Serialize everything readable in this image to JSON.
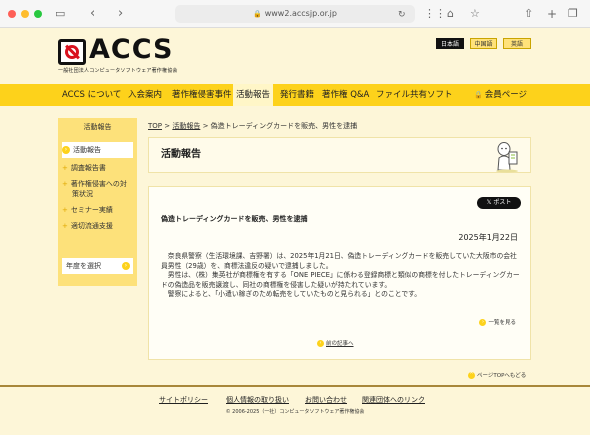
{
  "browser": {
    "url": "www2.accsjp.or.jp"
  },
  "header": {
    "logo": "ACCS",
    "logo_sub": "一般社団法人コンピュータソフトウェア著作権協会",
    "langs": [
      "日本語",
      "中国語",
      "英語"
    ]
  },
  "nav": {
    "items": [
      "ACCS について",
      "入会案内",
      "著作権侵害事件",
      "活動報告",
      "発行書籍",
      "著作権 Q&A",
      "ファイル共有ソフト"
    ],
    "member": "会員ページ"
  },
  "sidebar": {
    "title": "活動報告",
    "items": [
      "活動報告",
      "調査報告書",
      "著作権侵害への対策状況",
      "セミナー実績",
      "適切流通支援"
    ],
    "year_select": "年度を選択"
  },
  "breadcrumb": {
    "top": "TOP",
    "report": "活動報告",
    "current": "偽造トレーディングカードを販売、男性を逮捕"
  },
  "panel": {
    "title": "活動報告"
  },
  "article": {
    "x_post": "ポスト",
    "title": "偽造トレーディングカードを販売、男性を逮捕",
    "date": "2025年1月22日",
    "p1": "奈良県警察（生活環境課、吉野署）は、2025年1月21日、偽造トレーディングカードを販売していた大阪市の会社員男性（29歳）を、商標法違反の疑いで逮捕しました。",
    "p2": "男性は、（株）集英社が商標権を有する「ONE PIECE」に係わる登録商標と類似の商標を付したトレーディングカードの偽造品を販売譲渡し、同社の商標権を侵害した疑いが持たれています。",
    "p3": "警察によると、「小遣い稼ぎのため転売をしていたものと見られる」とのことです。",
    "list_link": "一覧を見る",
    "prev_link": "前の記事へ"
  },
  "page_top": "ページTOPへもどる",
  "footer": {
    "links": [
      "サイトポリシー",
      "個人情報の取り扱い",
      "お問い合わせ",
      "関連団体へのリンク"
    ],
    "copyright": "© 2006-2025（一社）コンピュータソフトウェア著作権協会"
  }
}
